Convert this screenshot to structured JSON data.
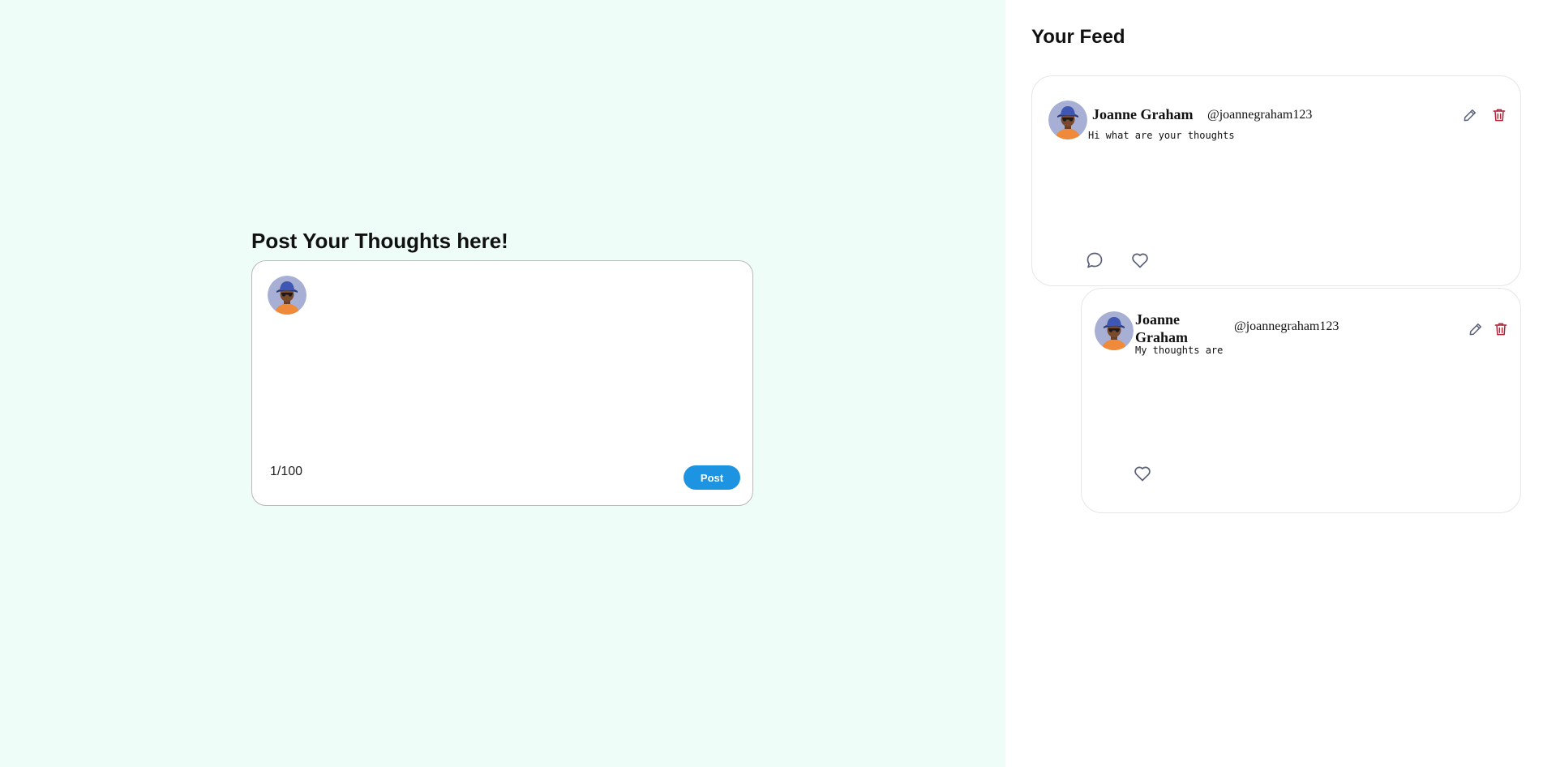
{
  "composer": {
    "title": "Post Your Thoughts here!",
    "input_value": "",
    "char_count": "1/100",
    "post_label": "Post",
    "avatar_icon": "user-avatar-icon"
  },
  "feed": {
    "title": "Your Feed",
    "posts": [
      {
        "author": "Joanne Graham",
        "handle": "@joannegraham123",
        "text": "Hi what are your thoughts",
        "actions": [
          "edit-icon",
          "delete-icon",
          "comment-icon",
          "heart-icon"
        ]
      },
      {
        "author": "Joanne Graham",
        "handle": "@joannegraham123",
        "text": "My thoughts are",
        "actions": [
          "edit-icon",
          "delete-icon",
          "heart-icon"
        ]
      }
    ]
  },
  "colors": {
    "composer_background": "#effdf9",
    "post_button": "#1d94e2",
    "delete_icon": "#b0243a",
    "action_icon": "#5a6178"
  }
}
